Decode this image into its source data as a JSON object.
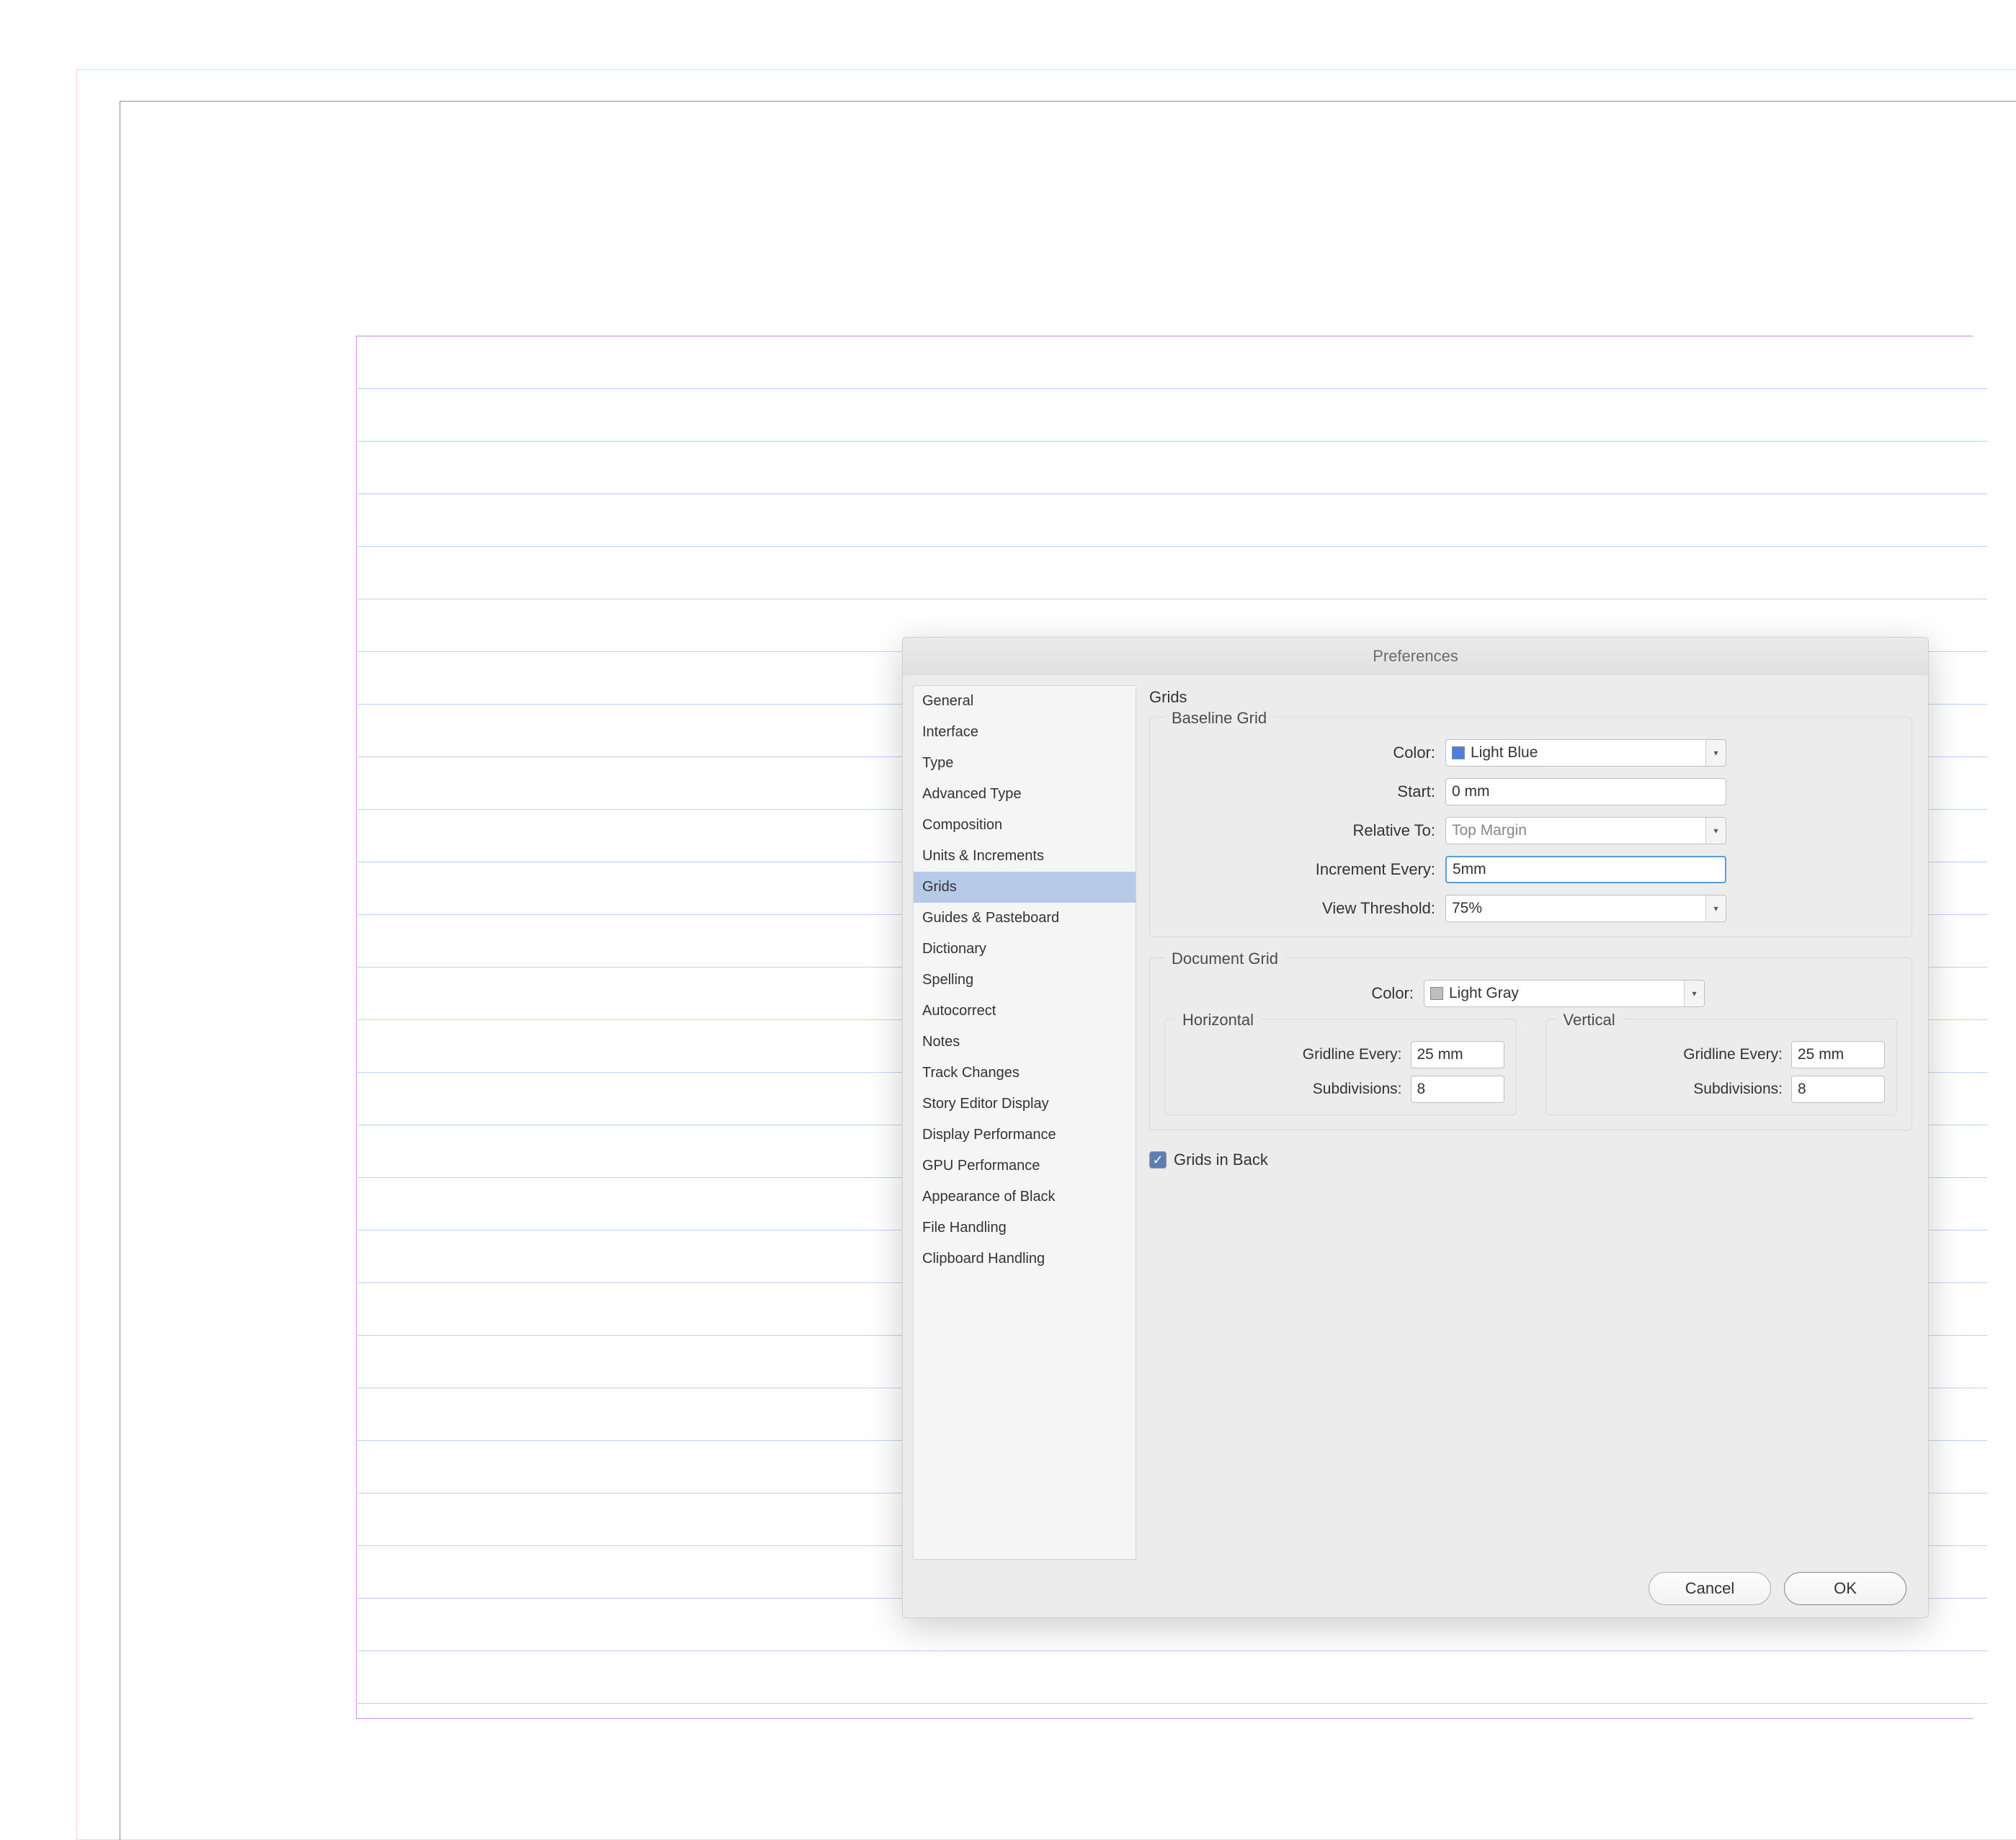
{
  "dialog": {
    "title": "Preferences",
    "panelTitle": "Grids"
  },
  "sidebar": {
    "items": [
      {
        "label": "General"
      },
      {
        "label": "Interface"
      },
      {
        "label": "Type"
      },
      {
        "label": "Advanced Type"
      },
      {
        "label": "Composition"
      },
      {
        "label": "Units & Increments"
      },
      {
        "label": "Grids"
      },
      {
        "label": "Guides & Pasteboard"
      },
      {
        "label": "Dictionary"
      },
      {
        "label": "Spelling"
      },
      {
        "label": "Autocorrect"
      },
      {
        "label": "Notes"
      },
      {
        "label": "Track Changes"
      },
      {
        "label": "Story Editor Display"
      },
      {
        "label": "Display Performance"
      },
      {
        "label": "GPU Performance"
      },
      {
        "label": "Appearance of Black"
      },
      {
        "label": "File Handling"
      },
      {
        "label": "Clipboard Handling"
      }
    ],
    "selectedIndex": 6
  },
  "baselineGrid": {
    "legend": "Baseline Grid",
    "colorLabel": "Color:",
    "colorValue": "Light Blue",
    "colorSwatch": "#4b7fe0",
    "startLabel": "Start:",
    "startValue": "0 mm",
    "relativeLabel": "Relative To:",
    "relativeValue": "Top Margin",
    "incrementLabel": "Increment Every:",
    "incrementValue": "5mm",
    "viewLabel": "View Threshold:",
    "viewValue": "75%"
  },
  "documentGrid": {
    "legend": "Document Grid",
    "colorLabel": "Color:",
    "colorValue": "Light Gray",
    "colorSwatch": "#bfbfbf",
    "horizontal": {
      "legend": "Horizontal",
      "gridlineLabel": "Gridline Every:",
      "gridlineValue": "25 mm",
      "subdivLabel": "Subdivisions:",
      "subdivValue": "8"
    },
    "vertical": {
      "legend": "Vertical",
      "gridlineLabel": "Gridline Every:",
      "gridlineValue": "25 mm",
      "subdivLabel": "Subdivisions:",
      "subdivValue": "8"
    }
  },
  "gridsInBack": {
    "label": "Grids in Back",
    "checked": true
  },
  "buttons": {
    "cancel": "Cancel",
    "ok": "OK"
  }
}
